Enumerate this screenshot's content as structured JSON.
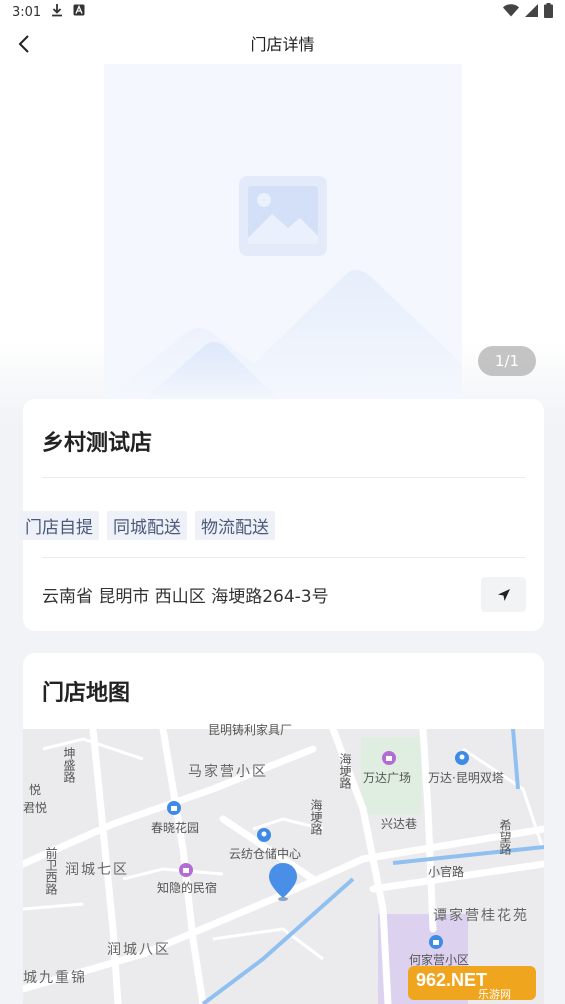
{
  "status_bar": {
    "time": "3:01"
  },
  "header": {
    "title": "门店详情"
  },
  "gallery": {
    "counter": "1/1"
  },
  "store": {
    "name": "乡村测试店",
    "tags": [
      "门店自提",
      "同城配送",
      "物流配送"
    ],
    "address": "云南省 昆明市 西山区 海埂路264-3号"
  },
  "map": {
    "title": "门店地图",
    "labels": {
      "top_road": "昆明铸利家具厂",
      "kunsheng_road": "坤盛路",
      "majiaying": "马家营小区",
      "haigeng_road_1": "海埂路",
      "haigeng_road_2": "海埂路",
      "wanda_plaza": "万达广场",
      "wanda_twin": "万达·昆明双塔",
      "xingda_lane": "兴达巷",
      "xiwang_road": "希望路",
      "junyue": "君悦",
      "yue": "悦",
      "chunxiao": "春晓花园",
      "yunfang": "云纺仓储中心",
      "qianwei": "前卫西路",
      "runcheng7": "润城七区",
      "zhiyin": "知隐的民宿",
      "xiaoguan": "小官路",
      "tanjiaying": "谭家营桂花苑",
      "runcheng8": "润城八区",
      "runcheng9": "城九重锦",
      "hejia": "何家营小区"
    },
    "watermark_main": "962.NET",
    "watermark_sub": "乐游网"
  }
}
